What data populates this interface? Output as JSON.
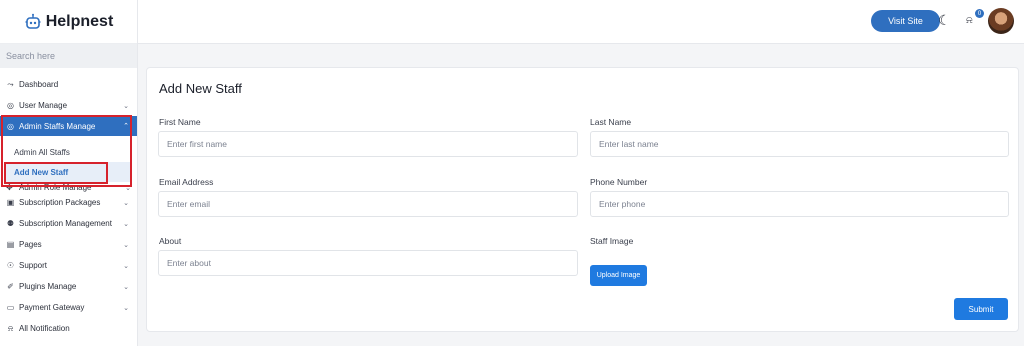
{
  "brand": {
    "name": "Helpnest"
  },
  "sidebar": {
    "search_placeholder": "Search here",
    "items": [
      {
        "label": "Dashboard",
        "icon": "dashboard-icon"
      },
      {
        "label": "User Manage",
        "icon": "user-icon"
      },
      {
        "label": "Admin Staffs Manage",
        "icon": "user-circle-icon"
      },
      {
        "label": "Admin Role Manage",
        "icon": "roles-icon"
      },
      {
        "label": "Subscription Packages",
        "icon": "calendar-icon"
      },
      {
        "label": "Subscription Management",
        "icon": "users-icon"
      },
      {
        "label": "Pages",
        "icon": "pages-icon"
      },
      {
        "label": "Support",
        "icon": "support-icon"
      },
      {
        "label": "Plugins Manage",
        "icon": "plug-icon"
      },
      {
        "label": "Payment Gateway",
        "icon": "card-icon"
      },
      {
        "label": "All Notification",
        "icon": "bell-icon"
      }
    ],
    "subitems": [
      {
        "label": "Admin All Staffs"
      },
      {
        "label": "Add New Staff"
      }
    ]
  },
  "header": {
    "visit_label": "Visit Site",
    "notification_count": "0"
  },
  "form": {
    "title": "Add New Staff",
    "first_name_label": "First Name",
    "first_name_placeholder": "Enter first name",
    "last_name_label": "Last Name",
    "last_name_placeholder": "Enter last name",
    "email_label": "Email Address",
    "email_placeholder": "Enter email",
    "phone_label": "Phone Number",
    "phone_placeholder": "Enter phone",
    "about_label": "About",
    "about_placeholder": "Enter about",
    "image_label": "Staff Image",
    "upload_label": "Upload Image",
    "submit_label": "Submit"
  },
  "colors": {
    "accent": "#2f6fbf",
    "button": "#1f7ae0",
    "highlight": "#d6222c"
  }
}
